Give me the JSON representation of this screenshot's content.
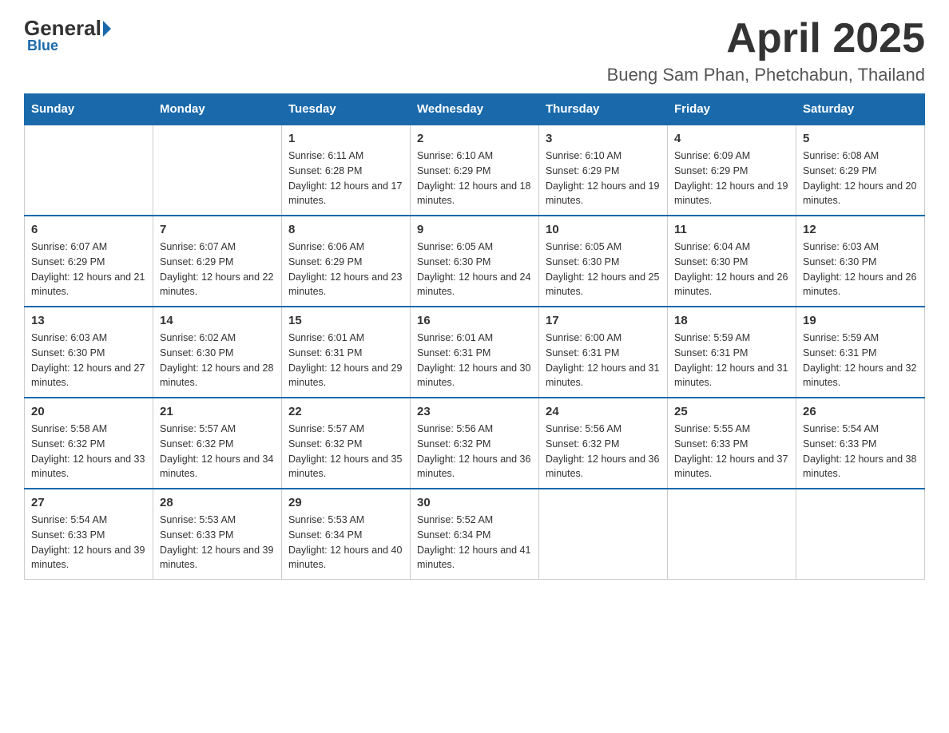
{
  "header": {
    "logo_general": "General",
    "logo_blue": "Blue",
    "month_title": "April 2025",
    "location": "Bueng Sam Phan, Phetchabun, Thailand"
  },
  "days_of_week": [
    "Sunday",
    "Monday",
    "Tuesday",
    "Wednesday",
    "Thursday",
    "Friday",
    "Saturday"
  ],
  "weeks": [
    [
      {
        "day": "",
        "sunrise": "",
        "sunset": "",
        "daylight": ""
      },
      {
        "day": "",
        "sunrise": "",
        "sunset": "",
        "daylight": ""
      },
      {
        "day": "1",
        "sunrise": "Sunrise: 6:11 AM",
        "sunset": "Sunset: 6:28 PM",
        "daylight": "Daylight: 12 hours and 17 minutes."
      },
      {
        "day": "2",
        "sunrise": "Sunrise: 6:10 AM",
        "sunset": "Sunset: 6:29 PM",
        "daylight": "Daylight: 12 hours and 18 minutes."
      },
      {
        "day": "3",
        "sunrise": "Sunrise: 6:10 AM",
        "sunset": "Sunset: 6:29 PM",
        "daylight": "Daylight: 12 hours and 19 minutes."
      },
      {
        "day": "4",
        "sunrise": "Sunrise: 6:09 AM",
        "sunset": "Sunset: 6:29 PM",
        "daylight": "Daylight: 12 hours and 19 minutes."
      },
      {
        "day": "5",
        "sunrise": "Sunrise: 6:08 AM",
        "sunset": "Sunset: 6:29 PM",
        "daylight": "Daylight: 12 hours and 20 minutes."
      }
    ],
    [
      {
        "day": "6",
        "sunrise": "Sunrise: 6:07 AM",
        "sunset": "Sunset: 6:29 PM",
        "daylight": "Daylight: 12 hours and 21 minutes."
      },
      {
        "day": "7",
        "sunrise": "Sunrise: 6:07 AM",
        "sunset": "Sunset: 6:29 PM",
        "daylight": "Daylight: 12 hours and 22 minutes."
      },
      {
        "day": "8",
        "sunrise": "Sunrise: 6:06 AM",
        "sunset": "Sunset: 6:29 PM",
        "daylight": "Daylight: 12 hours and 23 minutes."
      },
      {
        "day": "9",
        "sunrise": "Sunrise: 6:05 AM",
        "sunset": "Sunset: 6:30 PM",
        "daylight": "Daylight: 12 hours and 24 minutes."
      },
      {
        "day": "10",
        "sunrise": "Sunrise: 6:05 AM",
        "sunset": "Sunset: 6:30 PM",
        "daylight": "Daylight: 12 hours and 25 minutes."
      },
      {
        "day": "11",
        "sunrise": "Sunrise: 6:04 AM",
        "sunset": "Sunset: 6:30 PM",
        "daylight": "Daylight: 12 hours and 26 minutes."
      },
      {
        "day": "12",
        "sunrise": "Sunrise: 6:03 AM",
        "sunset": "Sunset: 6:30 PM",
        "daylight": "Daylight: 12 hours and 26 minutes."
      }
    ],
    [
      {
        "day": "13",
        "sunrise": "Sunrise: 6:03 AM",
        "sunset": "Sunset: 6:30 PM",
        "daylight": "Daylight: 12 hours and 27 minutes."
      },
      {
        "day": "14",
        "sunrise": "Sunrise: 6:02 AM",
        "sunset": "Sunset: 6:30 PM",
        "daylight": "Daylight: 12 hours and 28 minutes."
      },
      {
        "day": "15",
        "sunrise": "Sunrise: 6:01 AM",
        "sunset": "Sunset: 6:31 PM",
        "daylight": "Daylight: 12 hours and 29 minutes."
      },
      {
        "day": "16",
        "sunrise": "Sunrise: 6:01 AM",
        "sunset": "Sunset: 6:31 PM",
        "daylight": "Daylight: 12 hours and 30 minutes."
      },
      {
        "day": "17",
        "sunrise": "Sunrise: 6:00 AM",
        "sunset": "Sunset: 6:31 PM",
        "daylight": "Daylight: 12 hours and 31 minutes."
      },
      {
        "day": "18",
        "sunrise": "Sunrise: 5:59 AM",
        "sunset": "Sunset: 6:31 PM",
        "daylight": "Daylight: 12 hours and 31 minutes."
      },
      {
        "day": "19",
        "sunrise": "Sunrise: 5:59 AM",
        "sunset": "Sunset: 6:31 PM",
        "daylight": "Daylight: 12 hours and 32 minutes."
      }
    ],
    [
      {
        "day": "20",
        "sunrise": "Sunrise: 5:58 AM",
        "sunset": "Sunset: 6:32 PM",
        "daylight": "Daylight: 12 hours and 33 minutes."
      },
      {
        "day": "21",
        "sunrise": "Sunrise: 5:57 AM",
        "sunset": "Sunset: 6:32 PM",
        "daylight": "Daylight: 12 hours and 34 minutes."
      },
      {
        "day": "22",
        "sunrise": "Sunrise: 5:57 AM",
        "sunset": "Sunset: 6:32 PM",
        "daylight": "Daylight: 12 hours and 35 minutes."
      },
      {
        "day": "23",
        "sunrise": "Sunrise: 5:56 AM",
        "sunset": "Sunset: 6:32 PM",
        "daylight": "Daylight: 12 hours and 36 minutes."
      },
      {
        "day": "24",
        "sunrise": "Sunrise: 5:56 AM",
        "sunset": "Sunset: 6:32 PM",
        "daylight": "Daylight: 12 hours and 36 minutes."
      },
      {
        "day": "25",
        "sunrise": "Sunrise: 5:55 AM",
        "sunset": "Sunset: 6:33 PM",
        "daylight": "Daylight: 12 hours and 37 minutes."
      },
      {
        "day": "26",
        "sunrise": "Sunrise: 5:54 AM",
        "sunset": "Sunset: 6:33 PM",
        "daylight": "Daylight: 12 hours and 38 minutes."
      }
    ],
    [
      {
        "day": "27",
        "sunrise": "Sunrise: 5:54 AM",
        "sunset": "Sunset: 6:33 PM",
        "daylight": "Daylight: 12 hours and 39 minutes."
      },
      {
        "day": "28",
        "sunrise": "Sunrise: 5:53 AM",
        "sunset": "Sunset: 6:33 PM",
        "daylight": "Daylight: 12 hours and 39 minutes."
      },
      {
        "day": "29",
        "sunrise": "Sunrise: 5:53 AM",
        "sunset": "Sunset: 6:34 PM",
        "daylight": "Daylight: 12 hours and 40 minutes."
      },
      {
        "day": "30",
        "sunrise": "Sunrise: 5:52 AM",
        "sunset": "Sunset: 6:34 PM",
        "daylight": "Daylight: 12 hours and 41 minutes."
      },
      {
        "day": "",
        "sunrise": "",
        "sunset": "",
        "daylight": ""
      },
      {
        "day": "",
        "sunrise": "",
        "sunset": "",
        "daylight": ""
      },
      {
        "day": "",
        "sunrise": "",
        "sunset": "",
        "daylight": ""
      }
    ]
  ]
}
